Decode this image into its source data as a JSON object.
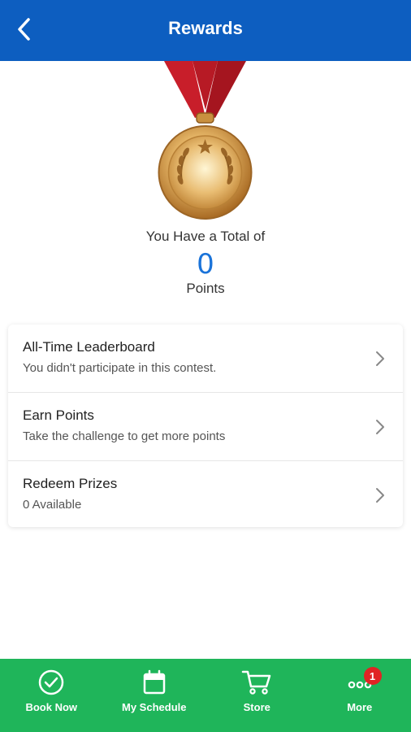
{
  "header": {
    "title": "Rewards"
  },
  "summary": {
    "total_label": "You Have a Total of",
    "points_value": "0",
    "points_label": "Points"
  },
  "menu": [
    {
      "title": "All-Time Leaderboard",
      "subtitle": "You didn't participate in this contest."
    },
    {
      "title": "Earn Points",
      "subtitle": "Take the challenge to get more points"
    },
    {
      "title": "Redeem Prizes",
      "subtitle": "0 Available"
    }
  ],
  "tabs": [
    {
      "label": "Book Now",
      "icon": "check-circle-icon"
    },
    {
      "label": "My Schedule",
      "icon": "calendar-icon"
    },
    {
      "label": "Store",
      "icon": "cart-icon"
    },
    {
      "label": "More",
      "icon": "more-dots-icon",
      "badge": "1"
    }
  ],
  "colors": {
    "header": "#0d5ec0",
    "tabbar": "#1fb55a",
    "points": "#1a73d9",
    "badge": "#e02424"
  }
}
